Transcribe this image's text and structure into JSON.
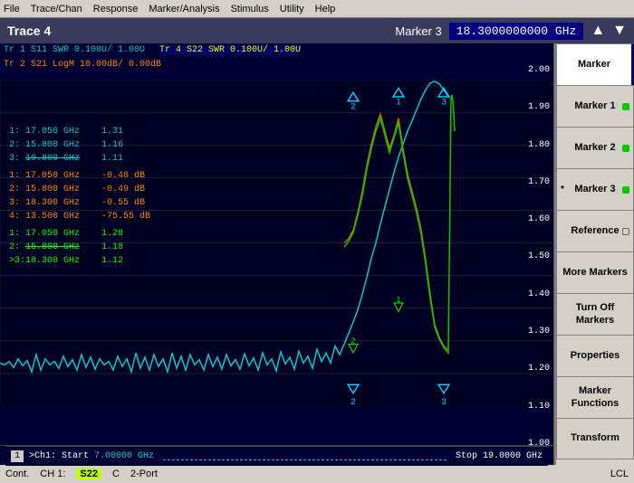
{
  "menu": {
    "items": [
      "File",
      "Trace/Chan",
      "Response",
      "Marker/Analysis",
      "Stimulus",
      "Utility",
      "Help"
    ]
  },
  "titlebar": {
    "trace_title": "Trace 4",
    "marker_label": "Marker 3",
    "frequency": "18.3000000000 GHz"
  },
  "chart_info": {
    "tr1_label": "Tr 1  S11 SWR 0.100U/  1.00U",
    "tr4_label": "Tr 4  S22 SWR 0.100U/  1.00U",
    "tr2_label": "Tr 2  S21 LogM 10.00dB/  0.00dB"
  },
  "marker_data": {
    "group1": [
      {
        "idx": "1:",
        "freq": "17.050 GHz",
        "val": "1.31",
        "color": "c1"
      },
      {
        "idx": "2:",
        "freq": "15.800 GHz",
        "val": "1.16",
        "color": "c1"
      },
      {
        "idx": "3:",
        "freq": "10.800 GHz",
        "val": "1.11",
        "color": "c1"
      }
    ],
    "group2": [
      {
        "idx": "1:",
        "freq": "17.050 GHz",
        "val": "-0.48 dB",
        "color": "c2"
      },
      {
        "idx": "2:",
        "freq": "15.800 GHz",
        "val": "-0.49 dB",
        "color": "c2"
      },
      {
        "idx": "3:",
        "freq": "18.300 GHz",
        "val": "-0.55 dB",
        "color": "c2"
      },
      {
        "idx": "4:",
        "freq": "13.500 GHz",
        "val": "-75.55 dB",
        "color": "c2"
      }
    ],
    "group3": [
      {
        "idx": "1:",
        "freq": "17.050 GHz",
        "val": "1.28",
        "color": "c3"
      },
      {
        "idx": "2:",
        "freq": "15.800 GHz",
        "val": "1.18",
        "color": "c3"
      },
      {
        "idx": ">3:",
        "freq": "18.300 GHz",
        "val": "1.12",
        "color": "c3"
      }
    ]
  },
  "y_axis": {
    "labels": [
      "2.00",
      "1.90",
      "1.80",
      "1.70",
      "1.60",
      "1.50",
      "1.40",
      "1.30",
      "1.20",
      "1.10",
      "1.00"
    ]
  },
  "bottom_bar": {
    "page": "1",
    "ch1_label": ">Ch1: Start",
    "start_freq": "7.00000 GHz",
    "stop_label": "Stop",
    "stop_freq": "19.0000 GHz"
  },
  "status_bar": {
    "cont": "Cont.",
    "ch1": "CH 1:",
    "s22": "S22",
    "c_label": "C",
    "port": "2-Port",
    "lcl": "LCL"
  },
  "sidebar": {
    "buttons": [
      {
        "label": "Marker",
        "active": true,
        "indicator": null
      },
      {
        "label": "Marker 1",
        "active": false,
        "indicator": "green"
      },
      {
        "label": "Marker 2",
        "active": false,
        "indicator": "green"
      },
      {
        "label": "* Marker 3",
        "active": false,
        "indicator": "green",
        "star": true
      },
      {
        "label": "Reference",
        "active": false,
        "indicator": "outline"
      },
      {
        "label": "More Markers",
        "active": false,
        "indicator": null
      },
      {
        "label": "Turn Off Markers",
        "active": false,
        "indicator": null
      },
      {
        "label": "Properties",
        "active": false,
        "indicator": null
      },
      {
        "label": "Marker Functions",
        "active": false,
        "indicator": null
      },
      {
        "label": "Transform",
        "active": false,
        "indicator": null
      }
    ]
  }
}
